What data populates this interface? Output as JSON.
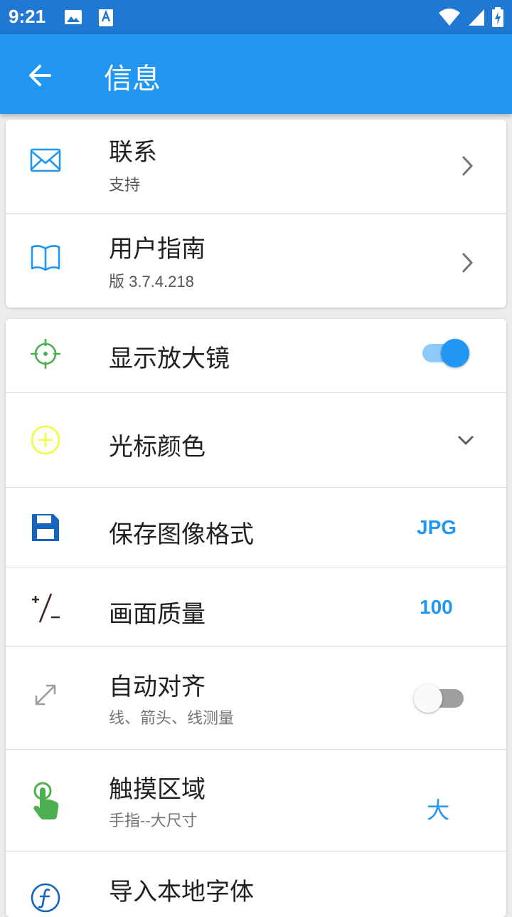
{
  "status_bar": {
    "time": "9:21"
  },
  "app_bar": {
    "title": "信息"
  },
  "card1": {
    "items": [
      {
        "title": "联系",
        "subtitle": "支持",
        "icon": "mail-icon"
      },
      {
        "title": "用户指南",
        "subtitle": "版 3.7.4.218",
        "icon": "book-icon"
      }
    ]
  },
  "settings": {
    "magnifier": {
      "title": "显示放大镜",
      "enabled": true
    },
    "cursor_color": {
      "title": "光标颜色",
      "color": "#eeff41"
    },
    "image_format": {
      "title": "保存图像格式",
      "value": "JPG"
    },
    "quality": {
      "title": "画面质量",
      "value": "100"
    },
    "auto_align": {
      "title": "自动对齐",
      "subtitle": "线、箭头、线测量",
      "enabled": false
    },
    "touch_area": {
      "title": "触摸区域",
      "subtitle": "手指--大尺寸",
      "value": "大"
    },
    "import_font": {
      "title": "导入本地字体"
    }
  },
  "colors": {
    "primary": "#2196f3",
    "status_bar": "#1f78d1",
    "green": "#4caf50"
  }
}
